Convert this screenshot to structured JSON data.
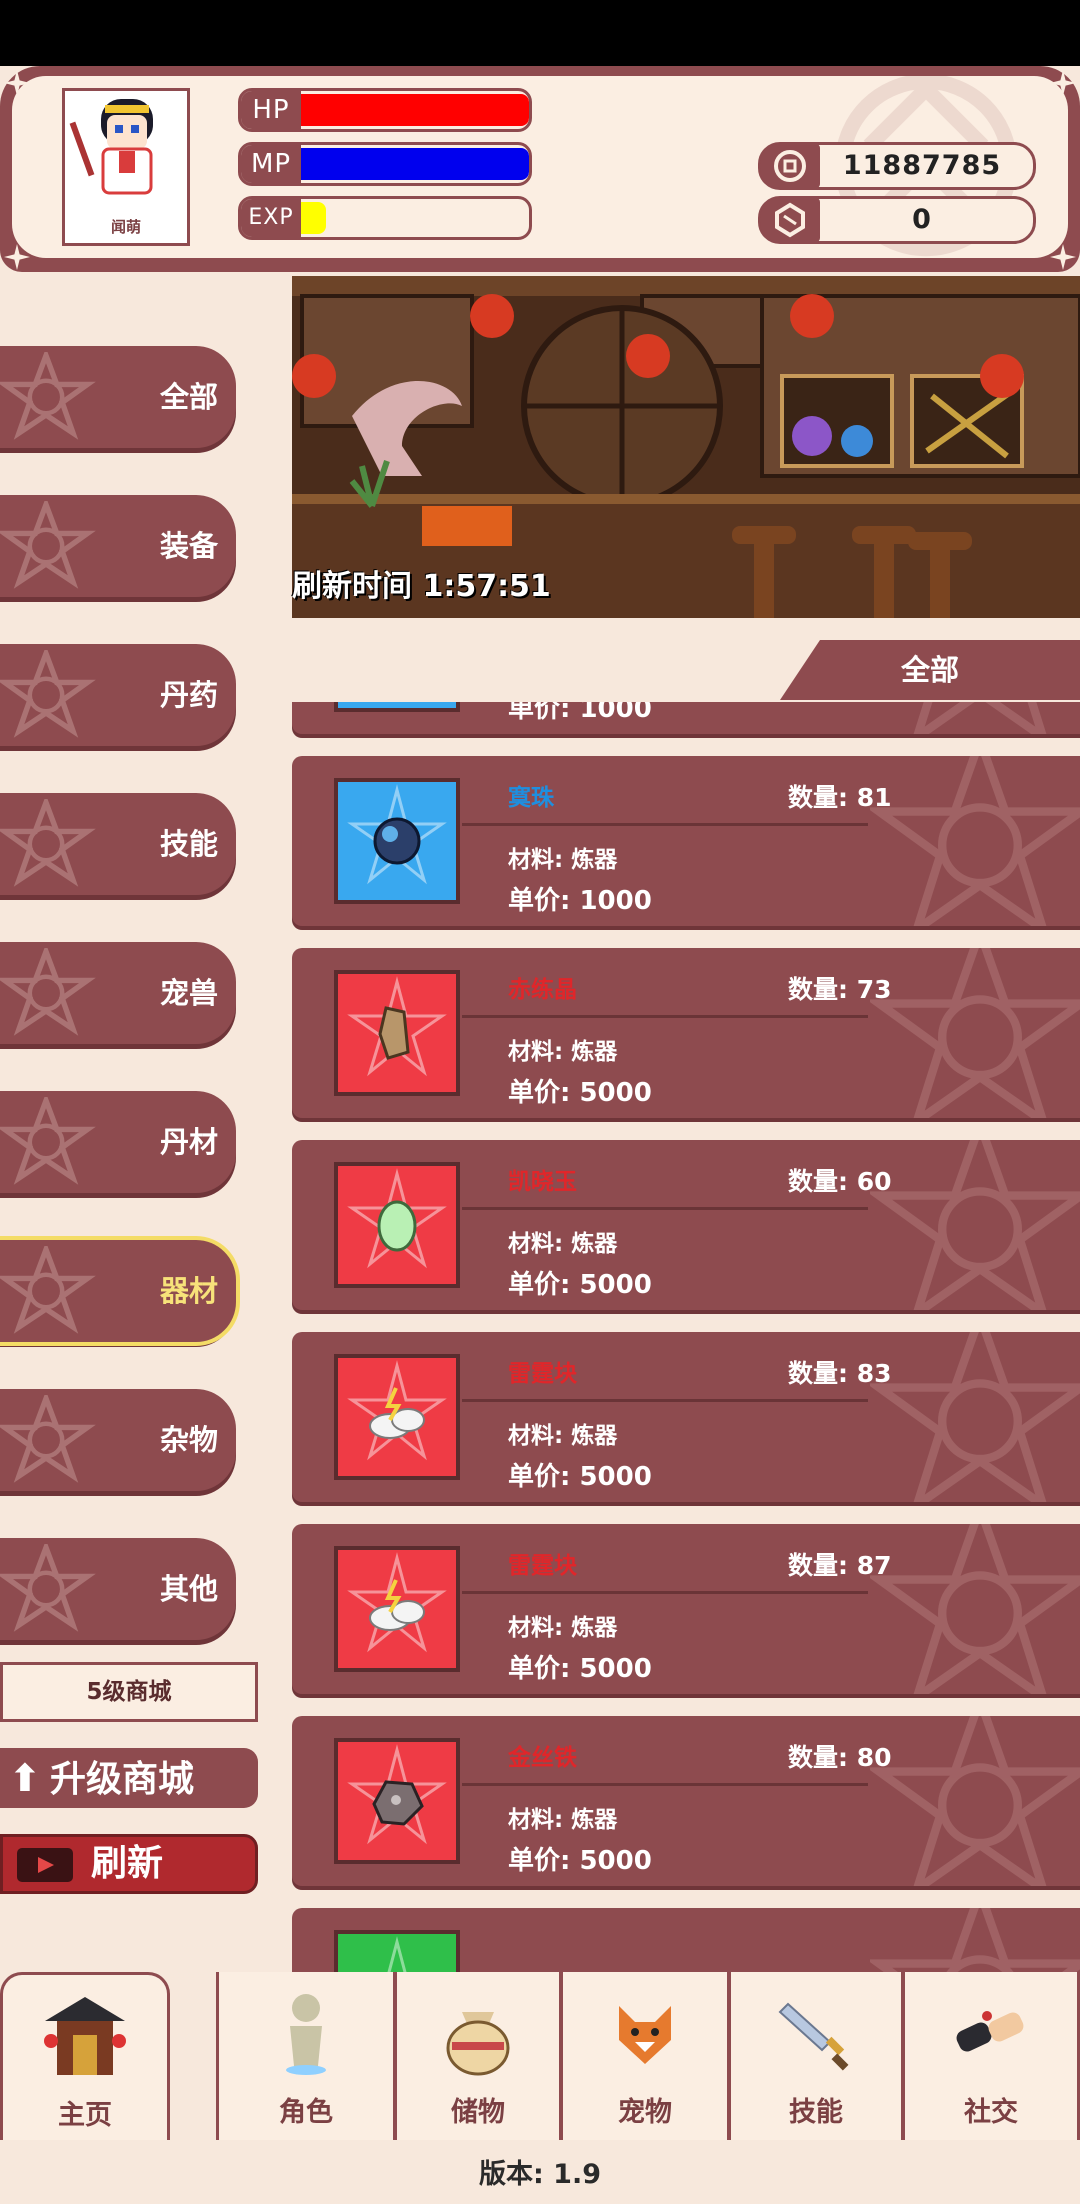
{
  "player": {
    "name": "闻萌",
    "hp_label": "HP",
    "mp_label": "MP",
    "exp_label": "EXP",
    "hp_fraction": 1.0,
    "mp_fraction": 1.0,
    "exp_fraction": 0.11,
    "coins": "11887785",
    "gems": "0"
  },
  "colors": {
    "panel": "#8e4b4f",
    "cream": "#fbeee2",
    "hp": "#ff0000",
    "mp": "#0000ee",
    "exp": "#ffff00",
    "rarity_blue": "#1e8fe0",
    "rarity_red": "#e0262a",
    "active_label": "#f7e27a"
  },
  "categories": [
    {
      "label": "全部",
      "active": false
    },
    {
      "label": "装备",
      "active": false
    },
    {
      "label": "丹药",
      "active": false
    },
    {
      "label": "技能",
      "active": false
    },
    {
      "label": "宠兽",
      "active": false
    },
    {
      "label": "丹材",
      "active": false
    },
    {
      "label": "器材",
      "active": true
    },
    {
      "label": "杂物",
      "active": false
    },
    {
      "label": "其他",
      "active": false
    }
  ],
  "shop": {
    "level_label": "5级商城",
    "upgrade_label": "升级商城",
    "refresh_label": "刷新",
    "refresh_timer": "刷新时间 1:57:51",
    "filter_label": "全部"
  },
  "items": [
    {
      "name": "",
      "qty_label": "",
      "material": "",
      "price": "单价: 1000",
      "rarity": "blue",
      "icon": "orb-icon"
    },
    {
      "name": "寞珠",
      "qty_label": "数量: 81",
      "material": "材料: 炼器",
      "price": "单价: 1000",
      "rarity": "blue",
      "icon": "orb-icon"
    },
    {
      "name": "赤练晶",
      "qty_label": "数量: 73",
      "material": "材料: 炼器",
      "price": "单价: 5000",
      "rarity": "red",
      "icon": "ore-shard-icon"
    },
    {
      "name": "凯晓玉",
      "qty_label": "数量: 60",
      "material": "材料: 炼器",
      "price": "单价: 5000",
      "rarity": "red",
      "icon": "jade-icon"
    },
    {
      "name": "雷霆块",
      "qty_label": "数量: 83",
      "material": "材料: 炼器",
      "price": "单价: 5000",
      "rarity": "red",
      "icon": "thunder-cloud-icon"
    },
    {
      "name": "雷霆块",
      "qty_label": "数量: 87",
      "material": "材料: 炼器",
      "price": "单价: 5000",
      "rarity": "red",
      "icon": "thunder-cloud-icon"
    },
    {
      "name": "金丝铁",
      "qty_label": "数量: 80",
      "material": "材料: 炼器",
      "price": "单价: 5000",
      "rarity": "red",
      "icon": "iron-ore-icon"
    },
    {
      "name": "",
      "qty_label": "",
      "material": "",
      "price": "",
      "rarity": "green",
      "icon": "item-icon"
    }
  ],
  "nav": [
    {
      "label": "主页",
      "icon": "gate-icon"
    },
    {
      "label": "角色",
      "icon": "figure-icon"
    },
    {
      "label": "储物",
      "icon": "bag-icon"
    },
    {
      "label": "宠物",
      "icon": "fox-icon"
    },
    {
      "label": "技能",
      "icon": "sword-icon"
    },
    {
      "label": "社交",
      "icon": "handshake-icon"
    }
  ],
  "version": "版本: 1.9"
}
